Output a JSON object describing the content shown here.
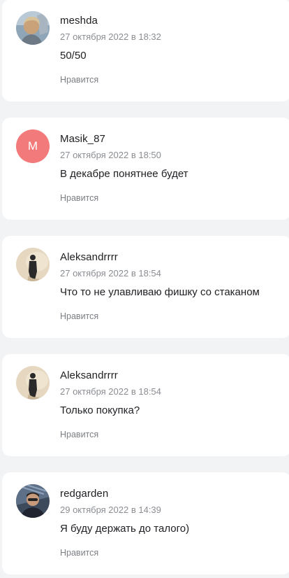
{
  "comments": [
    {
      "username": "meshda",
      "date": "27 октября 2022 в 18:32",
      "text": "50/50",
      "like_label": "Нравится",
      "avatar": "photo-avatar"
    },
    {
      "username": "Masik_87",
      "date": "27 октября 2022 в 18:50",
      "text": "В декабре понятнее будет",
      "like_label": "Нравится",
      "avatar_letter": "M",
      "avatar_color": "#f37a7a"
    },
    {
      "username": "Aleksandrrrr",
      "date": "27 октября 2022 в 18:54",
      "text": "Что то не улавливаю фишку со стаканом",
      "like_label": "Нравится",
      "avatar": "photo-avatar"
    },
    {
      "username": "Aleksandrrrr",
      "date": "27 октября 2022 в 18:54",
      "text": "Только покупка?",
      "like_label": "Нравится",
      "avatar": "photo-avatar"
    },
    {
      "username": "redgarden",
      "date": "29 октября 2022 в 14:39",
      "text": "Я буду держать до талого)",
      "like_label": "Нравится",
      "avatar": "photo-avatar"
    }
  ]
}
